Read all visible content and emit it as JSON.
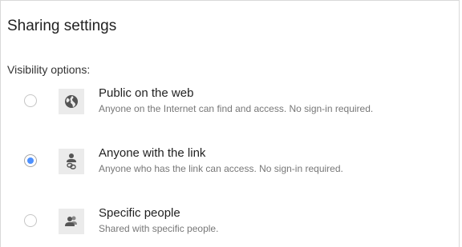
{
  "dialog": {
    "title": "Sharing settings",
    "visibility_label": "Visibility options:",
    "options": [
      {
        "title": "Public on the web",
        "description": "Anyone on the Internet can find and access. No sign-in required.",
        "icon": "globe-icon",
        "selected": false
      },
      {
        "title": "Anyone with the link",
        "description": "Anyone who has the link can access. No sign-in required.",
        "icon": "person-link-icon",
        "selected": true
      },
      {
        "title": "Specific people",
        "description": "Shared with specific people.",
        "icon": "people-icon",
        "selected": false
      }
    ]
  },
  "colors": {
    "accent": "#4d90fe",
    "icon_bg": "#ebebeb",
    "icon_fg": "#555555"
  }
}
